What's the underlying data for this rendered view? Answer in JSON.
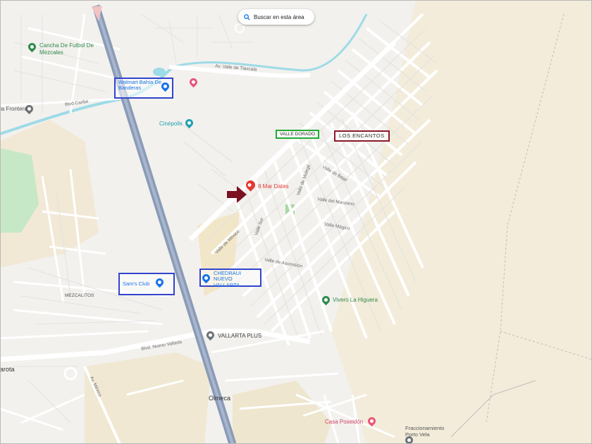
{
  "search": {
    "label": "Buscar en esta área"
  },
  "property": {
    "label": "8 Mar Dates"
  },
  "boxed_labels": {
    "valle_dorado": "VALLE DORADO",
    "los_encantos": "LOS ENCANTOS",
    "walmart": "Walmart Bahía De Banderas",
    "sams": "Sam's Club",
    "chedraui": "CHEDRAUI NUEVO VALLARTA"
  },
  "pois": {
    "cancha": "Cancha De Futbol De Mezcales",
    "cinepolis": "Cinépolis",
    "frontera": "la Frontera",
    "vivero": "Vivero La Higuera",
    "vallarta_plus": "VALLARTA PLUS",
    "casa_poseidon": "Casa Poseidón",
    "porto_vela": "Fraccionamiento Porto Vela"
  },
  "places": {
    "olmeca": "Olmeca",
    "mezcalitos": "MEZCALITOS",
    "laguna_left": "arota"
  },
  "roads": {
    "av_valle_tlaxcala": "Av. Valle de Tlaxcala",
    "av_mexico": "Valle de México",
    "blvd_nuevo_vallarta": "Blvd. Nuevo Vallarta",
    "valle_ascension": "Valle de Ascensión",
    "valle_manzano": "Valle del Manzano",
    "valle_magos": "Valle Mágico",
    "valle_bejar": "Valle de Bejar",
    "valle_mulegé": "Valle de Mulegé",
    "valle_sur": "Valle Sur",
    "playa_mexico": "Av. México",
    "blvd_caribe": "Blvd Caribe"
  },
  "colors": {
    "highway": "#8a9bb8",
    "water": "#9ddbe6",
    "green": "#c7e8c6",
    "sand": "#f3ecda",
    "poi_green": "#2f8a4a",
    "pin_red": "#e53935",
    "pin_pink": "#e8567a",
    "box_blue": "#3344cc",
    "box_green": "#22aa33",
    "box_red": "#8b1a2a",
    "arrow": "#7a1020"
  }
}
